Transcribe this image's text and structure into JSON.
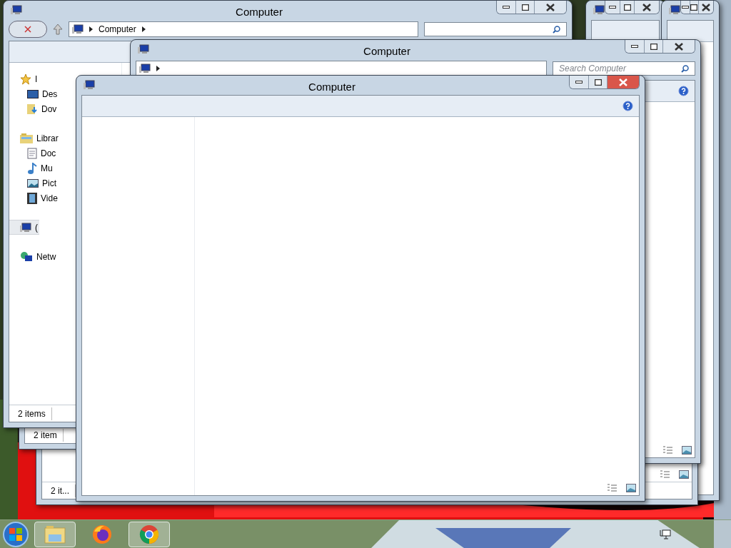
{
  "windows": [
    {
      "close_hover": false
    },
    {
      "close_hover": false
    },
    {
      "status": "2 it..."
    },
    {
      "status": "2 item"
    },
    {
      "title": "Computer",
      "close_hover": false,
      "address": {
        "crumbs": [
          "Computer"
        ]
      },
      "nav": [
        {
          "kind": "favorites",
          "label": "I",
          "selected": false
        },
        {
          "kind": "desktop",
          "label": "Des",
          "selected": false
        },
        {
          "kind": "downloads",
          "label": "Dov",
          "selected": false
        },
        {
          "kind": "libraries",
          "label": "Librar",
          "selected": false
        },
        {
          "kind": "documents",
          "label": "Doc",
          "selected": false
        },
        {
          "kind": "music",
          "label": "Mu",
          "selected": false
        },
        {
          "kind": "pictures",
          "label": "Pict",
          "selected": false
        },
        {
          "kind": "videos",
          "label": "Vide",
          "selected": false
        },
        {
          "kind": "computer",
          "label": "(",
          "selected": true
        },
        {
          "kind": "network",
          "label": "Netw",
          "selected": false
        }
      ],
      "status": "2 items"
    },
    {
      "title": "Computer",
      "address": {
        "search_placeholder": "Search Computer"
      },
      "help": true
    },
    {
      "title": "Computer",
      "close_hover": true,
      "help": true,
      "nav_pane": true
    }
  ],
  "taskbar": {
    "items": [
      {
        "kind": "explorer",
        "open": true
      },
      {
        "kind": "firefox",
        "open": false
      },
      {
        "kind": "chrome",
        "open": true
      }
    ]
  }
}
